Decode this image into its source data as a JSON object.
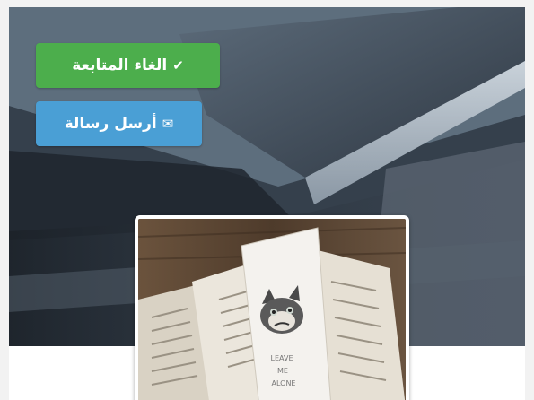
{
  "profile": {
    "unfollow_label": "الغاء المتابعة",
    "message_label": "أرسل رسالة",
    "unfollow_icon": "check-icon",
    "message_icon": "envelope-icon"
  },
  "avatar_image": {
    "bookmark_text": [
      "LEAVE",
      "ME",
      "ALONE"
    ]
  },
  "colors": {
    "unfollow_button": "#4cae4c",
    "message_button": "#4a9fd5"
  }
}
